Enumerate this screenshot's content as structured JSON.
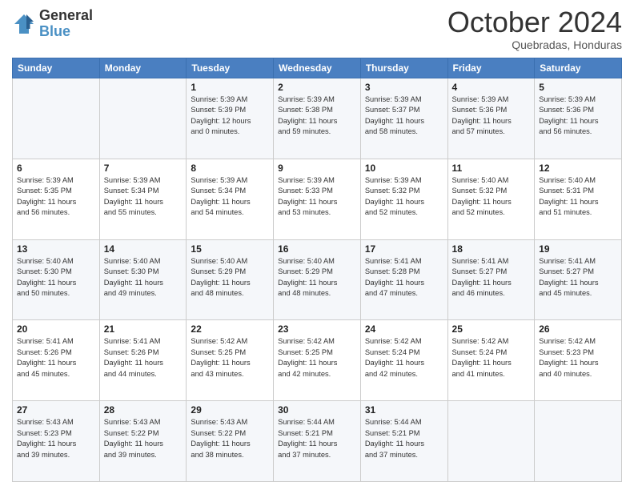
{
  "header": {
    "logo_line1": "General",
    "logo_line2": "Blue",
    "month": "October 2024",
    "location": "Quebradas, Honduras"
  },
  "weekdays": [
    "Sunday",
    "Monday",
    "Tuesday",
    "Wednesday",
    "Thursday",
    "Friday",
    "Saturday"
  ],
  "weeks": [
    [
      {
        "day": "",
        "info": ""
      },
      {
        "day": "",
        "info": ""
      },
      {
        "day": "1",
        "info": "Sunrise: 5:39 AM\nSunset: 5:39 PM\nDaylight: 12 hours\nand 0 minutes."
      },
      {
        "day": "2",
        "info": "Sunrise: 5:39 AM\nSunset: 5:38 PM\nDaylight: 11 hours\nand 59 minutes."
      },
      {
        "day": "3",
        "info": "Sunrise: 5:39 AM\nSunset: 5:37 PM\nDaylight: 11 hours\nand 58 minutes."
      },
      {
        "day": "4",
        "info": "Sunrise: 5:39 AM\nSunset: 5:36 PM\nDaylight: 11 hours\nand 57 minutes."
      },
      {
        "day": "5",
        "info": "Sunrise: 5:39 AM\nSunset: 5:36 PM\nDaylight: 11 hours\nand 56 minutes."
      }
    ],
    [
      {
        "day": "6",
        "info": "Sunrise: 5:39 AM\nSunset: 5:35 PM\nDaylight: 11 hours\nand 56 minutes."
      },
      {
        "day": "7",
        "info": "Sunrise: 5:39 AM\nSunset: 5:34 PM\nDaylight: 11 hours\nand 55 minutes."
      },
      {
        "day": "8",
        "info": "Sunrise: 5:39 AM\nSunset: 5:34 PM\nDaylight: 11 hours\nand 54 minutes."
      },
      {
        "day": "9",
        "info": "Sunrise: 5:39 AM\nSunset: 5:33 PM\nDaylight: 11 hours\nand 53 minutes."
      },
      {
        "day": "10",
        "info": "Sunrise: 5:39 AM\nSunset: 5:32 PM\nDaylight: 11 hours\nand 52 minutes."
      },
      {
        "day": "11",
        "info": "Sunrise: 5:40 AM\nSunset: 5:32 PM\nDaylight: 11 hours\nand 52 minutes."
      },
      {
        "day": "12",
        "info": "Sunrise: 5:40 AM\nSunset: 5:31 PM\nDaylight: 11 hours\nand 51 minutes."
      }
    ],
    [
      {
        "day": "13",
        "info": "Sunrise: 5:40 AM\nSunset: 5:30 PM\nDaylight: 11 hours\nand 50 minutes."
      },
      {
        "day": "14",
        "info": "Sunrise: 5:40 AM\nSunset: 5:30 PM\nDaylight: 11 hours\nand 49 minutes."
      },
      {
        "day": "15",
        "info": "Sunrise: 5:40 AM\nSunset: 5:29 PM\nDaylight: 11 hours\nand 48 minutes."
      },
      {
        "day": "16",
        "info": "Sunrise: 5:40 AM\nSunset: 5:29 PM\nDaylight: 11 hours\nand 48 minutes."
      },
      {
        "day": "17",
        "info": "Sunrise: 5:41 AM\nSunset: 5:28 PM\nDaylight: 11 hours\nand 47 minutes."
      },
      {
        "day": "18",
        "info": "Sunrise: 5:41 AM\nSunset: 5:27 PM\nDaylight: 11 hours\nand 46 minutes."
      },
      {
        "day": "19",
        "info": "Sunrise: 5:41 AM\nSunset: 5:27 PM\nDaylight: 11 hours\nand 45 minutes."
      }
    ],
    [
      {
        "day": "20",
        "info": "Sunrise: 5:41 AM\nSunset: 5:26 PM\nDaylight: 11 hours\nand 45 minutes."
      },
      {
        "day": "21",
        "info": "Sunrise: 5:41 AM\nSunset: 5:26 PM\nDaylight: 11 hours\nand 44 minutes."
      },
      {
        "day": "22",
        "info": "Sunrise: 5:42 AM\nSunset: 5:25 PM\nDaylight: 11 hours\nand 43 minutes."
      },
      {
        "day": "23",
        "info": "Sunrise: 5:42 AM\nSunset: 5:25 PM\nDaylight: 11 hours\nand 42 minutes."
      },
      {
        "day": "24",
        "info": "Sunrise: 5:42 AM\nSunset: 5:24 PM\nDaylight: 11 hours\nand 42 minutes."
      },
      {
        "day": "25",
        "info": "Sunrise: 5:42 AM\nSunset: 5:24 PM\nDaylight: 11 hours\nand 41 minutes."
      },
      {
        "day": "26",
        "info": "Sunrise: 5:42 AM\nSunset: 5:23 PM\nDaylight: 11 hours\nand 40 minutes."
      }
    ],
    [
      {
        "day": "27",
        "info": "Sunrise: 5:43 AM\nSunset: 5:23 PM\nDaylight: 11 hours\nand 39 minutes."
      },
      {
        "day": "28",
        "info": "Sunrise: 5:43 AM\nSunset: 5:22 PM\nDaylight: 11 hours\nand 39 minutes."
      },
      {
        "day": "29",
        "info": "Sunrise: 5:43 AM\nSunset: 5:22 PM\nDaylight: 11 hours\nand 38 minutes."
      },
      {
        "day": "30",
        "info": "Sunrise: 5:44 AM\nSunset: 5:21 PM\nDaylight: 11 hours\nand 37 minutes."
      },
      {
        "day": "31",
        "info": "Sunrise: 5:44 AM\nSunset: 5:21 PM\nDaylight: 11 hours\nand 37 minutes."
      },
      {
        "day": "",
        "info": ""
      },
      {
        "day": "",
        "info": ""
      }
    ]
  ]
}
